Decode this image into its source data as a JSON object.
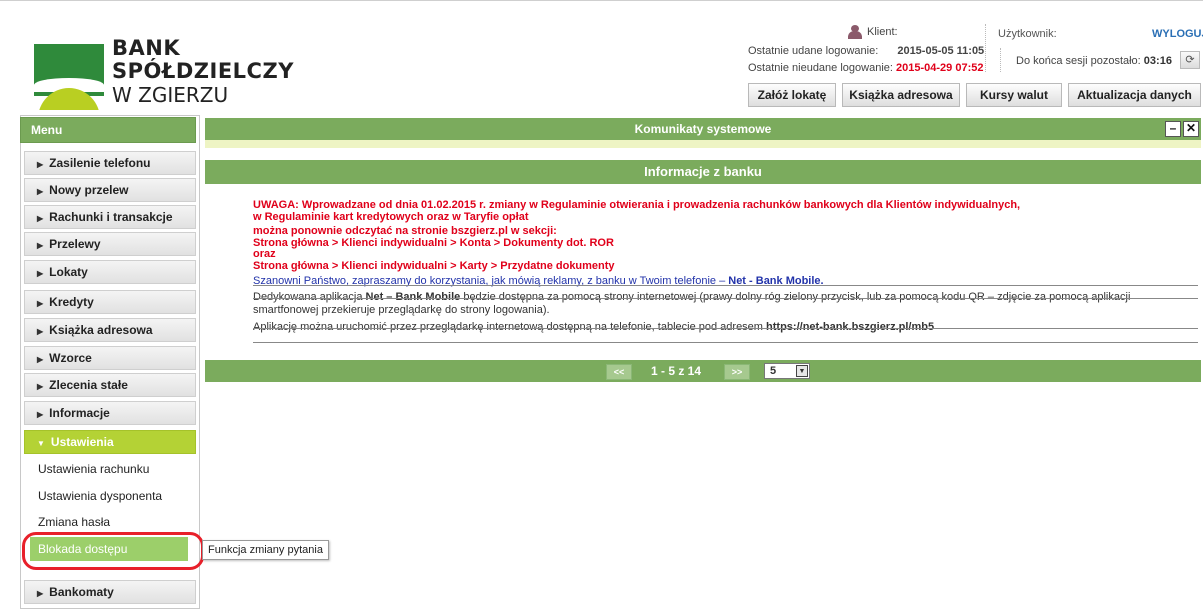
{
  "bank": {
    "name_line1": "BANK",
    "name_line2": "SPÓŁDZIELCZY",
    "name_line3": "W ZGIERZU"
  },
  "header": {
    "client_label": "Klient:",
    "user_label": "Użytkownik:",
    "logout_label": "WYLOGUJ",
    "last_success_label": "Ostatnie udane logowanie:",
    "last_success_value": "2015-05-05 11:05",
    "last_fail_label": "Ostatnie nieudane logowanie:",
    "last_fail_value": "2015-04-29 07:52",
    "session_label": "Do końca sesji pozostało:",
    "session_value": "03:16",
    "refresh_icon": "refresh-icon"
  },
  "toolbar": {
    "buttons": [
      "Załóż lokatę",
      "Książka adresowa",
      "Kursy walut",
      "Aktualizacja danych"
    ]
  },
  "menu": {
    "title": "Menu",
    "items": [
      "Zasilenie telefonu",
      "Nowy przelew",
      "Rachunki i transakcje",
      "Przelewy",
      "Lokaty",
      "Kredyty",
      "Książka adresowa",
      "Wzorce",
      "Zlecenia stałe",
      "Informacje"
    ],
    "active": "Ustawienia",
    "subitems": [
      "Ustawienia rachunku",
      "Ustawienia dysponenta",
      "Zmiana hasła",
      "Blokada dostępu"
    ],
    "last": "Bankomaty",
    "tooltip": "Funkcja zmiany pytania"
  },
  "komunikaty": {
    "title": "Komunikaty systemowe"
  },
  "info": {
    "title": "Informacje z banku",
    "red_lines": [
      "UWAGA: Wprowadzane od dnia 01.02.2015 r. zmiany w Regulaminie otwierania i prowadzenia rachunków bankowych dla Klientów indywidualnych,",
      "w Regulaminie kart kredytowych oraz w Taryfie opłat",
      "można ponownie odczytać na stronie bszgierz.pl w sekcji:",
      "Strona główna > Klienci indywidualni > Konta > Dokumenty dot. ROR",
      "oraz",
      "Strona główna > Klienci indywidualni > Karty > Przydatne dokumenty"
    ],
    "blue_line_pre": "Szanowni Państwo, zapraszamy do korzystania, jak mówią reklamy, z banku w Twoim telefonie – ",
    "blue_line_bold": "Net - Bank Mobile.",
    "dark_line1_pre": "Dedykowana aplikacja ",
    "dark_line1_bold": "Net – Bank Mobile",
    "dark_line1_post": " będzie dostępna za pomocą strony internetowej (prawy dolny róg zielony przycisk, lub za pomocą kodu QR – zdjęcie za pomocą aplikacji smartfonowej przekieruje przeglądarkę do strony logowania).",
    "dark_line2_pre": "Aplikację można uruchomić przez przeglądarkę internetową dostępną na telefonie, tablecie pod adresem ",
    "dark_line2_bold": "https://net-bank.bszgierz.pl/mb5"
  },
  "pager": {
    "prev": "<<",
    "text": "1 - 5 z 14",
    "next": ">>",
    "per_page": "5"
  }
}
